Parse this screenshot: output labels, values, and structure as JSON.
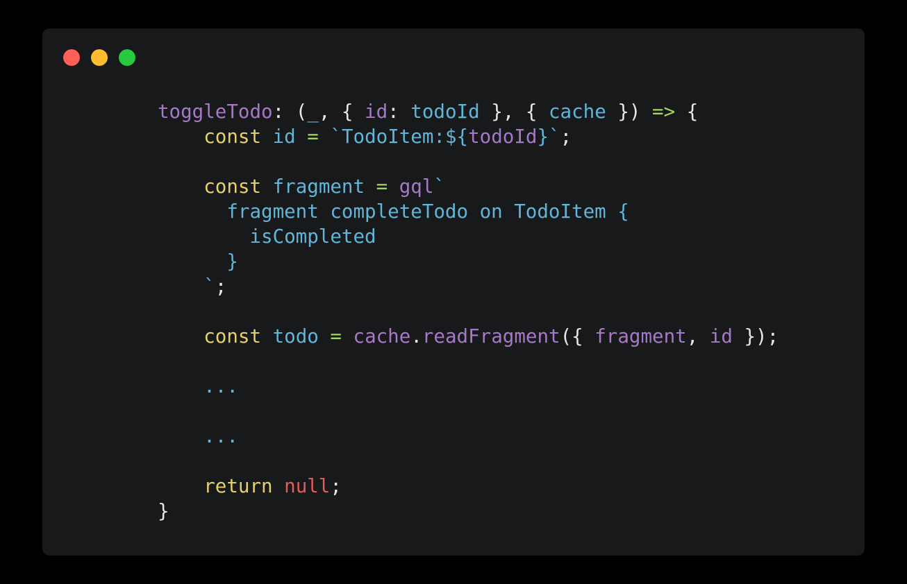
{
  "window": {
    "controls": [
      {
        "name": "close-button",
        "color": "#ff5f56"
      },
      {
        "name": "minimize-button",
        "color": "#ffbd2e"
      },
      {
        "name": "maximize-button",
        "color": "#27c93f"
      }
    ]
  },
  "colors": {
    "background": "#000000",
    "editor_background": "#18191b",
    "plain": "#e6e6e6",
    "keyword": "#e6d06c",
    "identifier": "#60b5d8",
    "property": "#a678c8",
    "operator": "#a4d65e",
    "literal": "#e55a5a"
  },
  "code_lines": [
    [
      {
        "t": "toggleTodo",
        "c": "property"
      },
      {
        "t": ": (",
        "c": "plain"
      },
      {
        "t": "_",
        "c": "identifier"
      },
      {
        "t": ", { ",
        "c": "plain"
      },
      {
        "t": "id",
        "c": "property"
      },
      {
        "t": ": ",
        "c": "plain"
      },
      {
        "t": "todoId",
        "c": "identifier"
      },
      {
        "t": " }, { ",
        "c": "plain"
      },
      {
        "t": "cache",
        "c": "identifier"
      },
      {
        "t": " }) ",
        "c": "plain"
      },
      {
        "t": "=>",
        "c": "operator"
      },
      {
        "t": " {",
        "c": "plain"
      }
    ],
    [
      {
        "t": "    ",
        "c": "plain"
      },
      {
        "t": "const",
        "c": "keyword"
      },
      {
        "t": " ",
        "c": "plain"
      },
      {
        "t": "id",
        "c": "identifier"
      },
      {
        "t": " ",
        "c": "plain"
      },
      {
        "t": "=",
        "c": "operator"
      },
      {
        "t": " ",
        "c": "plain"
      },
      {
        "t": "`TodoItem:${",
        "c": "identifier"
      },
      {
        "t": "todoId",
        "c": "property"
      },
      {
        "t": "}`",
        "c": "identifier"
      },
      {
        "t": ";",
        "c": "plain"
      }
    ],
    [],
    [
      {
        "t": "    ",
        "c": "plain"
      },
      {
        "t": "const",
        "c": "keyword"
      },
      {
        "t": " ",
        "c": "plain"
      },
      {
        "t": "fragment",
        "c": "identifier"
      },
      {
        "t": " ",
        "c": "plain"
      },
      {
        "t": "=",
        "c": "operator"
      },
      {
        "t": " ",
        "c": "plain"
      },
      {
        "t": "gql",
        "c": "property"
      },
      {
        "t": "`",
        "c": "identifier"
      }
    ],
    [
      {
        "t": "      ",
        "c": "plain"
      },
      {
        "t": "fragment completeTodo on TodoItem {",
        "c": "identifier"
      }
    ],
    [
      {
        "t": "        ",
        "c": "plain"
      },
      {
        "t": "isCompleted",
        "c": "identifier"
      }
    ],
    [
      {
        "t": "      ",
        "c": "plain"
      },
      {
        "t": "}",
        "c": "identifier"
      }
    ],
    [
      {
        "t": "    ",
        "c": "plain"
      },
      {
        "t": "`",
        "c": "identifier"
      },
      {
        "t": ";",
        "c": "plain"
      }
    ],
    [],
    [
      {
        "t": "    ",
        "c": "plain"
      },
      {
        "t": "const",
        "c": "keyword"
      },
      {
        "t": " ",
        "c": "plain"
      },
      {
        "t": "todo",
        "c": "identifier"
      },
      {
        "t": " ",
        "c": "plain"
      },
      {
        "t": "=",
        "c": "operator"
      },
      {
        "t": " ",
        "c": "plain"
      },
      {
        "t": "cache",
        "c": "property"
      },
      {
        "t": ".",
        "c": "plain"
      },
      {
        "t": "readFragment",
        "c": "property"
      },
      {
        "t": "({ ",
        "c": "plain"
      },
      {
        "t": "fragment",
        "c": "property"
      },
      {
        "t": ", ",
        "c": "plain"
      },
      {
        "t": "id",
        "c": "property"
      },
      {
        "t": " });",
        "c": "plain"
      }
    ],
    [],
    [
      {
        "t": "    ",
        "c": "plain"
      },
      {
        "t": "...",
        "c": "identifier"
      }
    ],
    [],
    [
      {
        "t": "    ",
        "c": "plain"
      },
      {
        "t": "...",
        "c": "identifier"
      }
    ],
    [],
    [
      {
        "t": "    ",
        "c": "plain"
      },
      {
        "t": "return",
        "c": "keyword"
      },
      {
        "t": " ",
        "c": "plain"
      },
      {
        "t": "null",
        "c": "literal"
      },
      {
        "t": ";",
        "c": "plain"
      }
    ],
    [
      {
        "t": "}",
        "c": "plain"
      }
    ]
  ]
}
